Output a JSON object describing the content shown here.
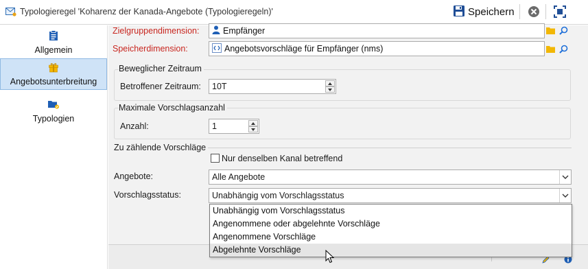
{
  "window": {
    "title": "Typologieregel 'Koharenz der Kanada-Angebote (Typologieregeln)'",
    "save_label": "Speichern"
  },
  "sidebar": {
    "items": [
      {
        "label": "Allgemein",
        "icon": "clipboard-icon"
      },
      {
        "label": "Angebotsunterbreitung",
        "icon": "gift-icon",
        "active": true
      },
      {
        "label": "Typologien",
        "icon": "folder-typology-icon"
      }
    ]
  },
  "form": {
    "target_dimension": {
      "label": "Zielgruppendimension:",
      "value": "Empfänger"
    },
    "storage_dimension": {
      "label": "Speicherdimension:",
      "value": "Angebotsvorschläge für Empfänger (nms)"
    },
    "period_group": {
      "title": "Beweglicher Zeitraum",
      "label": "Betroffener Zeitraum:",
      "value": "10T"
    },
    "max_group": {
      "title": "Maximale Vorschlagsanzahl",
      "label": "Anzahl:",
      "value": "1"
    },
    "count_section": {
      "title": "Zu zählende Vorschläge",
      "same_channel_label": "Nur denselben Kanal betreffend",
      "same_channel_checked": false,
      "offers_label": "Angebote:",
      "offers_value": "Alle Angebote",
      "status_label": "Vorschlagsstatus:",
      "status_value": "Unabhängig vom Vorschlagsstatus",
      "status_options": [
        "Unabhängig vom Vorschlagsstatus",
        "Angenommene oder abgelehnte Vorschläge",
        "Angenommene Vorschläge",
        "Abgelehnte Vorschläge"
      ],
      "hovered_option": "Abgelehnte Vorschläge"
    }
  },
  "colors": {
    "accent": "#cfe3f7",
    "required_label": "#c8261f",
    "folder": "#f2b705",
    "search": "#1e6fd9"
  }
}
